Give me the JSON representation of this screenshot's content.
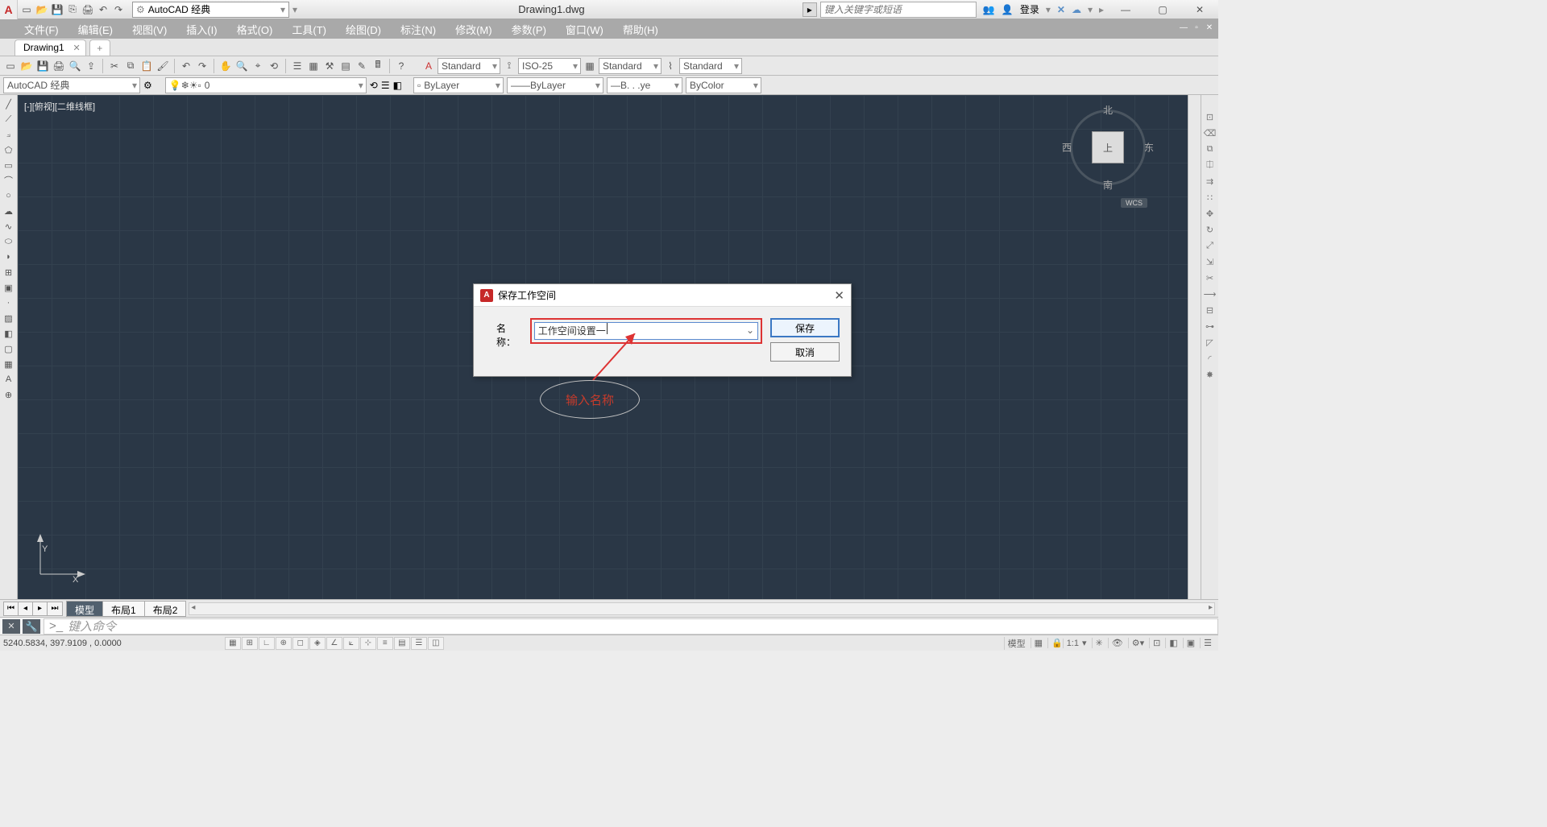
{
  "titlebar": {
    "workspace": "AutoCAD 经典",
    "doc": "Drawing1.dwg",
    "search_ph": "键入关键字或短语",
    "login": "登录"
  },
  "menus": [
    "文件(F)",
    "编辑(E)",
    "视图(V)",
    "插入(I)",
    "格式(O)",
    "工具(T)",
    "绘图(D)",
    "标注(N)",
    "修改(M)",
    "参数(P)",
    "窗口(W)",
    "帮助(H)"
  ],
  "doctab": {
    "name": "Drawing1"
  },
  "styles": {
    "text": "Standard",
    "dim": "ISO-25",
    "table": "Standard",
    "ml": "Standard"
  },
  "row2": {
    "ws": "AutoCAD 经典",
    "layer": "0",
    "bylayer": "ByLayer",
    "ltype": "ByLayer",
    "lweight": "B. . .ye",
    "color": "ByColor"
  },
  "canvas": {
    "viewlabel": "[-][俯视][二维线框]",
    "cube_top": "上",
    "n": "北",
    "s": "南",
    "e": "东",
    "w": "西",
    "wcs": "WCS",
    "x": "X",
    "y": "Y"
  },
  "dialog": {
    "title": "保存工作空间",
    "label": "名称：",
    "value": "工作空间设置一",
    "save": "保存",
    "cancel": "取消"
  },
  "annotation": {
    "text": "输入名称"
  },
  "btabs": {
    "model": "模型",
    "l1": "布局1",
    "l2": "布局2"
  },
  "cmd": {
    "placeholder": "键入命令",
    "prompt": ">_"
  },
  "status": {
    "coords": "5240.5834, 397.9109 , 0.0000",
    "model": "模型",
    "scale": "1:1"
  }
}
